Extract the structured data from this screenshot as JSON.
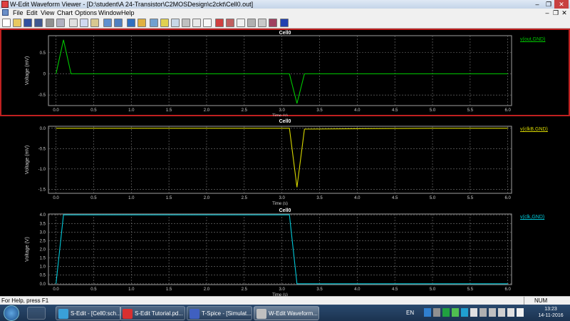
{
  "window": {
    "title": "W-Edit Waveform Viewer - [D:\\student\\A 24-Transistor\\C2MOSDesign\\c2ckt\\Cell0.out]",
    "controls": {
      "minimize": "–",
      "restore": "❐",
      "close": "✕"
    }
  },
  "menu": {
    "items": [
      "File",
      "Edit",
      "View",
      "Chart",
      "Options",
      "Window",
      "Help"
    ]
  },
  "toolbar": {
    "buttons": [
      "new",
      "open",
      "save",
      "save-all",
      "print",
      "print-preview",
      "cut",
      "copy",
      "paste",
      "tile-horizontal",
      "tile-vertical",
      "home",
      "open-data",
      "chart-properties",
      "layout-a",
      "layout-b",
      "layout-c",
      "text-label",
      "horizontal-line",
      "measure",
      "play",
      "pause",
      "step",
      "snapshot",
      "info"
    ]
  },
  "panes": [
    {
      "title": "Cell0",
      "legend": "v(out,GND)",
      "legend_color": "#00c800",
      "trace_color": "#00c800",
      "active": true,
      "chart_data": {
        "type": "line",
        "title": "Cell0",
        "xlabel": "Time (s)",
        "ylabel": "Voltage (mV)",
        "xlim": [
          -0.1,
          6.05
        ],
        "ylim": [
          -0.75,
          0.9
        ],
        "x_ticks": [
          "0.0",
          "0.5",
          "1.0",
          "1.5",
          "2.0",
          "2.5",
          "3.0",
          "3.5",
          "4.0",
          "4.5",
          "5.0",
          "5.5",
          "6.0"
        ],
        "y_ticks": [
          "0.5",
          "0",
          "-0.5"
        ],
        "y_tick_values": [
          0.5,
          0,
          -0.5
        ],
        "grid": true,
        "series": [
          {
            "name": "v(out,GND)",
            "x": [
              0,
              0.1,
              0.2,
              3.1,
              3.2,
              3.3,
              6.0
            ],
            "y": [
              0,
              0.8,
              0,
              0,
              -0.7,
              0,
              0
            ]
          }
        ]
      }
    },
    {
      "title": "Cell0",
      "legend": "v(clkB,GND)",
      "legend_color": "#d8d800",
      "trace_color": "#d8d800",
      "active": false,
      "chart_data": {
        "type": "line",
        "title": "Cell0",
        "xlabel": "Time (s)",
        "ylabel": "Voltage (mV)",
        "xlim": [
          -0.1,
          6.05
        ],
        "ylim": [
          -1.6,
          0.05
        ],
        "x_ticks": [
          "0.0",
          "0.5",
          "1.0",
          "1.5",
          "2.0",
          "2.5",
          "3.0",
          "3.5",
          "4.0",
          "4.5",
          "5.0",
          "5.5",
          "6.0"
        ],
        "y_ticks": [
          "0.0",
          "-0.5",
          "-1.0",
          "-1.5"
        ],
        "y_tick_values": [
          0.0,
          -0.5,
          -1.0,
          -1.5
        ],
        "grid": true,
        "series": [
          {
            "name": "v(clkB,GND)",
            "x": [
              0,
              3.1,
              3.2,
              3.3,
              4.0,
              5.0,
              6.0
            ],
            "y": [
              0,
              0,
              -1.45,
              -0.02,
              -0.01,
              0,
              0
            ]
          }
        ]
      }
    },
    {
      "title": "Cell0",
      "legend": "v(clk,GND)",
      "legend_color": "#00c8d8",
      "trace_color": "#00c8d8",
      "active": false,
      "chart_data": {
        "type": "line",
        "title": "Cell0",
        "xlabel": "Time (s)",
        "ylabel": "Voltage (V)",
        "xlim": [
          -0.1,
          6.05
        ],
        "ylim": [
          -0.05,
          4.05
        ],
        "x_ticks": [
          "0.0",
          "0.5",
          "1.0",
          "1.5",
          "2.0",
          "2.5",
          "3.0",
          "3.5",
          "4.0",
          "4.5",
          "5.0",
          "5.5",
          "6.0"
        ],
        "y_ticks": [
          "4.0",
          "3.5",
          "3.0",
          "2.5",
          "2.0",
          "1.5",
          "1.0",
          "0.5",
          "0.0"
        ],
        "y_tick_values": [
          4.0,
          3.5,
          3.0,
          2.5,
          2.0,
          1.5,
          1.0,
          0.5,
          0.0
        ],
        "grid": true,
        "series": [
          {
            "name": "v(clk,GND)",
            "x": [
              0,
              0.1,
              3.1,
              3.2,
              6.0
            ],
            "y": [
              0,
              4.0,
              4.0,
              0,
              0
            ]
          }
        ]
      }
    }
  ],
  "statusbar": {
    "help_text": "For Help, press F1",
    "num": "NUM"
  },
  "taskbar": {
    "tasks": [
      {
        "label": "S-Edit - [Cell0:sch...",
        "icon_color": "#3aa0d8"
      },
      {
        "label": "S-Edit Tutorial.pd...",
        "icon_color": "#d83030"
      },
      {
        "label": "T-Spice - [Simulat...",
        "icon_color": "#4060c0"
      },
      {
        "label": "W-Edit Waveform...",
        "icon_color": "#c0c0c0"
      }
    ],
    "language": "EN",
    "time": "13:23",
    "date": "14-11-2016"
  }
}
